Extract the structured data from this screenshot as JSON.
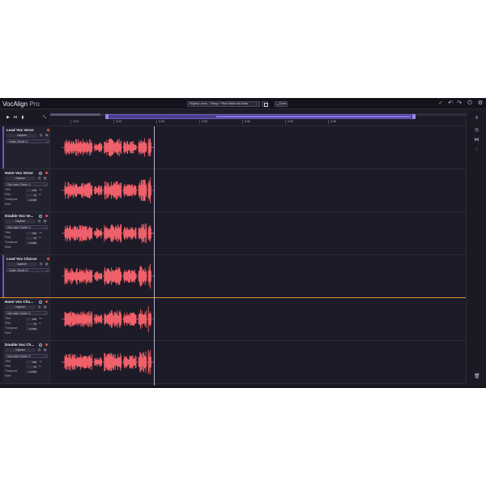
{
  "app": {
    "title": "VocAlign",
    "title_suffix": "Pro"
  },
  "toolbar": {
    "preset_value": "Slightly Loose - Timing + Pitch Match All Notes",
    "done_label": "Done"
  },
  "timeline": {
    "ticks": [
      "0:15",
      "0:20",
      "0:25",
      "0:30",
      "0:35",
      "0:40",
      "0:45"
    ]
  },
  "tracks": [
    {
      "name": "Lead Vox Verse",
      "capture_label": "Capture",
      "s_label": "S",
      "m_label": "M",
      "guide_label": "Guide (Guide 1)"
    },
    {
      "name": "Harm Vox Verse",
      "capture_label": "Capture",
      "s_label": "S",
      "m_label": "M",
      "guide_label": "Dub track (Guide 1)",
      "params": {
        "time_label": "Time",
        "time_value": "100",
        "time_unit": "ms",
        "pitch_label": "Pitch",
        "pitch_value": "70",
        "pitch_unit": "%",
        "transpose_label": "Transpose",
        "transpose_value": "+0.000",
        "more_label": "More"
      }
    },
    {
      "name": "Double Vox Ve...",
      "capture_label": "Capture",
      "s_label": "S",
      "m_label": "M",
      "guide_label": "Dub track (Guide 1)",
      "params": {
        "time_label": "Time",
        "time_value": "100",
        "time_unit": "ms",
        "pitch_label": "Pitch",
        "pitch_value": "70",
        "pitch_unit": "%",
        "transpose_label": "Transpose",
        "transpose_value": "+0.000",
        "more_label": "More"
      }
    },
    {
      "name": "Lead Vox Chorus",
      "capture_label": "Capture",
      "s_label": "S",
      "m_label": "M",
      "guide_label": "Guide (Guide 2)"
    },
    {
      "name": "Harm Vox Cho...",
      "capture_label": "Capture",
      "s_label": "S",
      "m_label": "M",
      "guide_label": "Dub track (Guide 2)",
      "params": {
        "time_label": "Time",
        "time_value": "100",
        "time_unit": "ms",
        "pitch_label": "Pitch",
        "pitch_value": "70",
        "pitch_unit": "%",
        "transpose_label": "Transpose",
        "transpose_value": "+0.000",
        "more_label": "More"
      }
    },
    {
      "name": "Double Vox Ch...",
      "capture_label": "Capture",
      "s_label": "S",
      "m_label": "M",
      "guide_label": "Dub track (Guide 2)",
      "params": {
        "time_label": "Time",
        "time_value": "100",
        "time_unit": "ms",
        "pitch_label": "Pitch",
        "pitch_value": "70",
        "pitch_unit": "%",
        "transpose_label": "Transpose",
        "transpose_value": "+0.000",
        "more_label": "More"
      }
    }
  ],
  "colors": {
    "waveform": "#f0606a",
    "accent": "#6e5bc2",
    "active_track_line": "#e08a3c",
    "record_dot": "#e5534b",
    "status_ok": "#3cc47c"
  },
  "icons": {
    "play": "play-icon",
    "align": "align-icon",
    "meter": "meter-icon",
    "expand": "expand-icon",
    "status": "check-circle-icon",
    "undo": "undo-icon",
    "redo": "redo-icon",
    "power": "power-icon",
    "settings": "gear-icon",
    "list": "list-icon",
    "history": "clock-icon",
    "waveform": "waveform-icon",
    "mixer": "mixer-icon",
    "delete": "trash-icon"
  }
}
